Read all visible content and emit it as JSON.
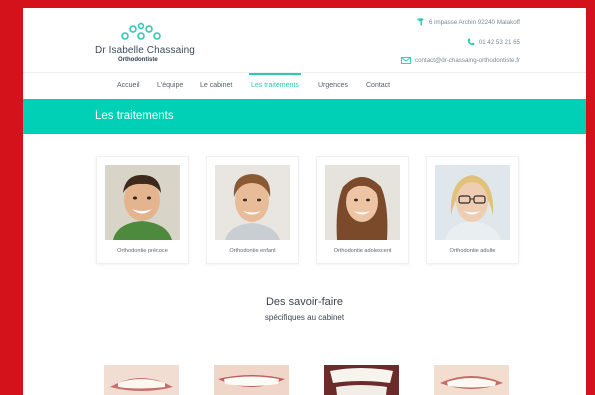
{
  "header": {
    "logo_name": "Dr Isabelle Chassaing",
    "logo_subtitle": "Orthodontiste",
    "address": "6 impasse Archin 92240 Malakoff",
    "phone": "01 42 53 21 65",
    "email": "contact@dr-chassaing-orthodontiste.fr"
  },
  "nav": {
    "items": [
      {
        "label": "Accueil"
      },
      {
        "label": "L'équipe"
      },
      {
        "label": "Le cabinet"
      },
      {
        "label": "Les traitements"
      },
      {
        "label": "Urgences"
      },
      {
        "label": "Contact"
      }
    ],
    "active": "Les traitements"
  },
  "banner": {
    "title": "Les traitements"
  },
  "treatments": [
    {
      "label": "Orthodontie précoce"
    },
    {
      "label": "Orthodontie enfant"
    },
    {
      "label": "Orthodontie adolescent"
    },
    {
      "label": "Orthodontie adulte"
    }
  ],
  "savoir_faire": {
    "title": "Des savoir-faire",
    "subtitle": "spécifiques au cabinet"
  },
  "colors": {
    "frame": "#d3121b",
    "accent": "#00d0b5",
    "text": "#3d4650"
  }
}
